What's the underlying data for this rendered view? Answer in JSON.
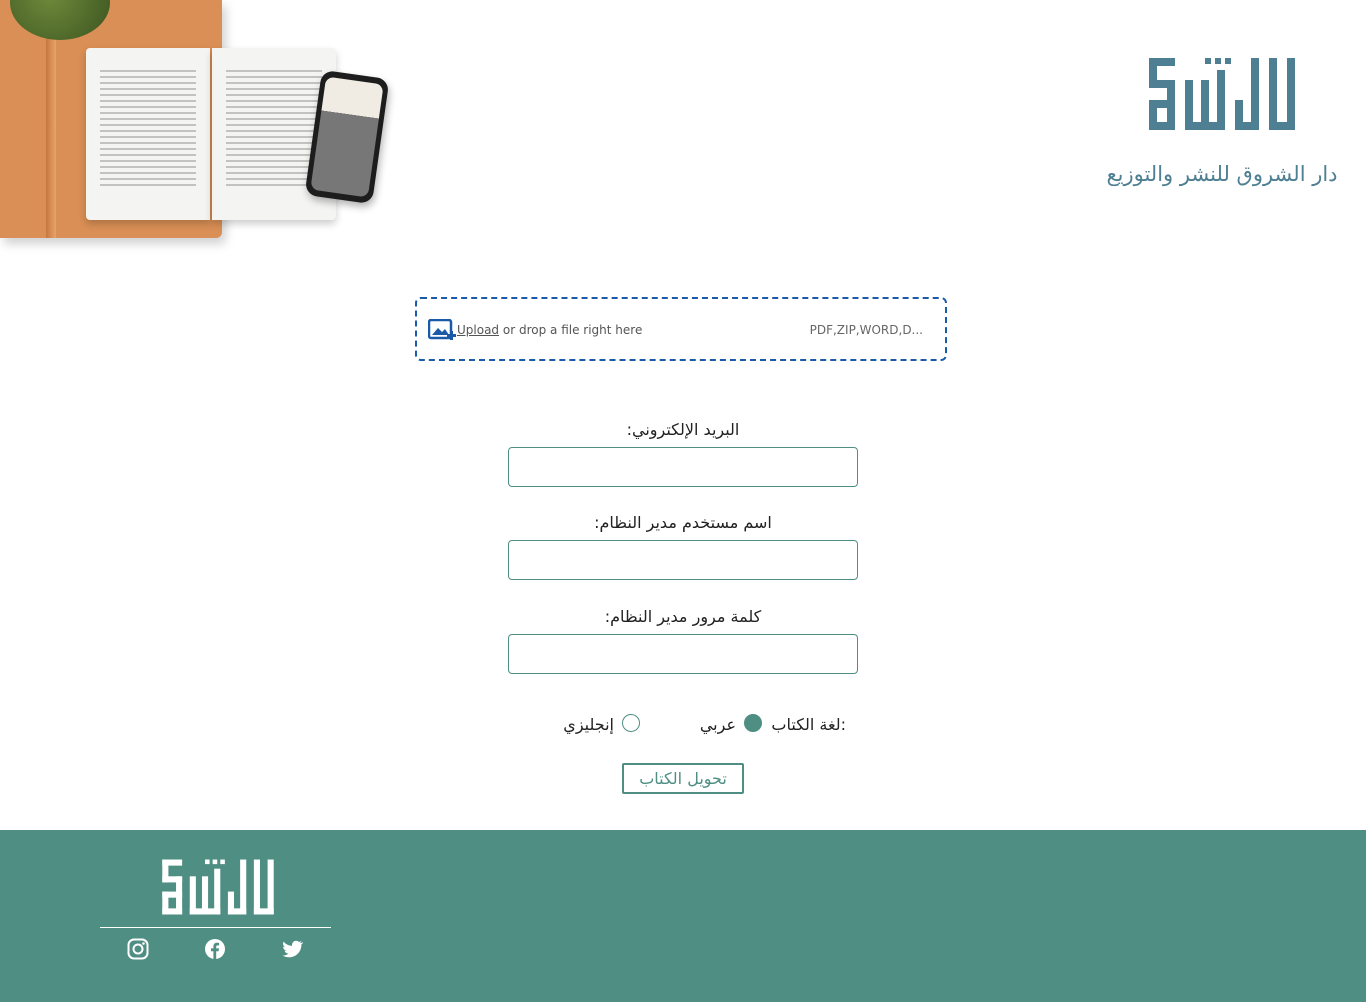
{
  "brand": {
    "tagline": "دار الشروق للنشر والتوزيع",
    "logo_icon": "alshorouk-logo-icon",
    "accent_color": "#4f7f92"
  },
  "hero": {
    "image": "open-book-and-phone-image"
  },
  "upload": {
    "link_label": "Upload",
    "text": "or drop a file right here",
    "formats": "PDF,ZIP,WORD,D...",
    "icon": "image-upload-icon"
  },
  "form": {
    "email_label": "البريد الإلكتروني:",
    "email_value": "",
    "username_label": "اسم مستخدم مدير النظام:",
    "username_value": "",
    "password_label": "كلمة مرور مدير النظام:",
    "password_value": "",
    "language_label": "لغة الكتاب:",
    "languages": [
      {
        "label": "عربي",
        "selected": true
      },
      {
        "label": "إنجليزي",
        "selected": false
      }
    ],
    "submit_label": "تحويل الكتاب"
  },
  "footer": {
    "background": "#4e8e83",
    "social": [
      "instagram-icon",
      "facebook-icon",
      "twitter-icon"
    ]
  }
}
